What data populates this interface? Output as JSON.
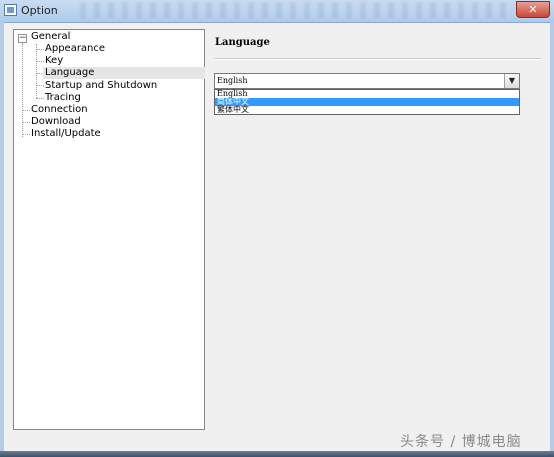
{
  "window": {
    "title": "Option",
    "close_label": "✕"
  },
  "tree": {
    "root": {
      "label": "General",
      "expander": "−"
    },
    "children": [
      {
        "label": "Appearance"
      },
      {
        "label": "Key"
      },
      {
        "label": "Language",
        "selected": true
      },
      {
        "label": "Startup and Shutdown"
      },
      {
        "label": "Tracing"
      }
    ],
    "siblings": [
      {
        "label": "Connection"
      },
      {
        "label": "Download"
      },
      {
        "label": "Install/Update"
      }
    ]
  },
  "panel": {
    "section_title": "Language",
    "language_select": {
      "value": "English",
      "arrow": "▼",
      "options": [
        "English",
        "简体中文",
        "繁体中文"
      ],
      "highlighted_index": 1
    }
  },
  "watermark": "头条号 / 博城电脑"
}
